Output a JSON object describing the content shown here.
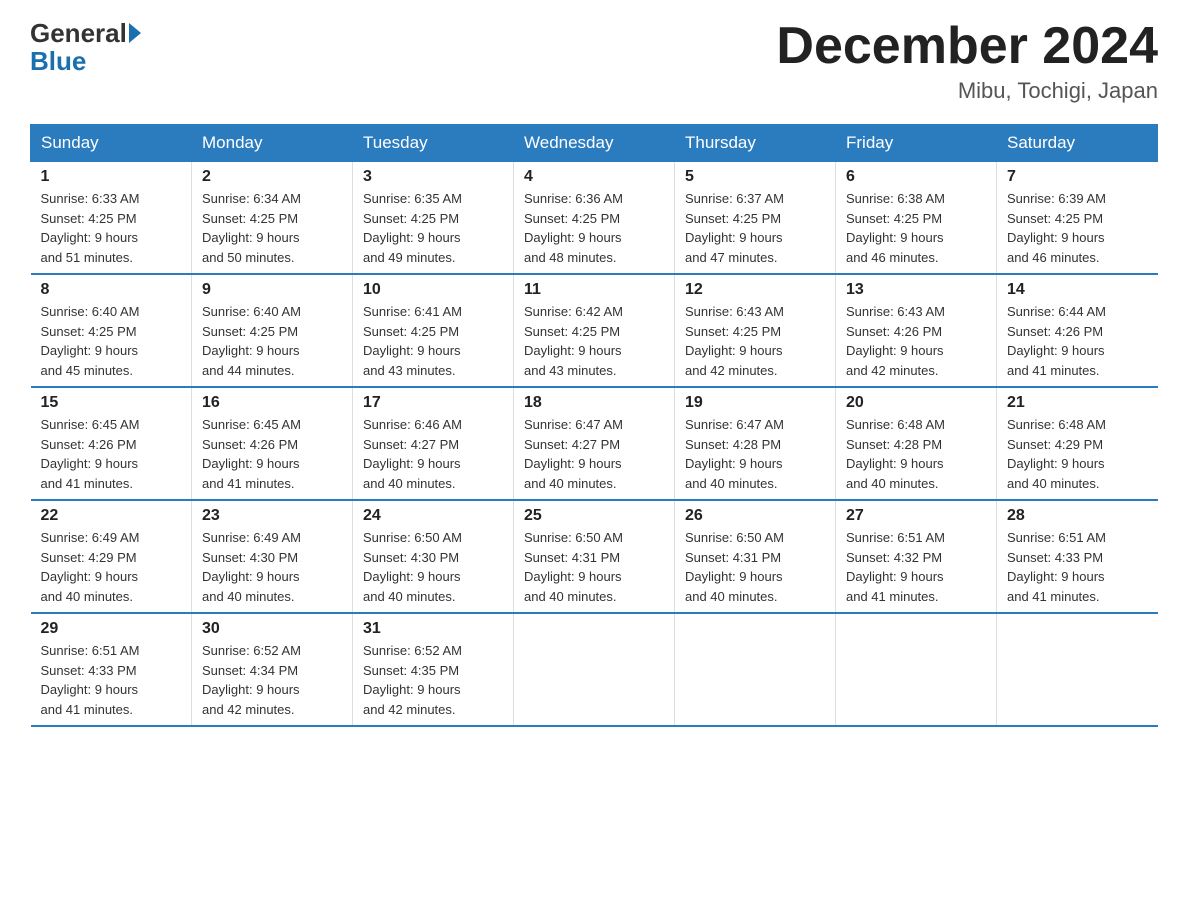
{
  "header": {
    "logo_general": "General",
    "logo_blue": "Blue",
    "month_title": "December 2024",
    "location": "Mibu, Tochigi, Japan"
  },
  "weekdays": [
    "Sunday",
    "Monday",
    "Tuesday",
    "Wednesday",
    "Thursday",
    "Friday",
    "Saturday"
  ],
  "weeks": [
    [
      {
        "day": "1",
        "sunrise": "6:33 AM",
        "sunset": "4:25 PM",
        "daylight": "9 hours and 51 minutes."
      },
      {
        "day": "2",
        "sunrise": "6:34 AM",
        "sunset": "4:25 PM",
        "daylight": "9 hours and 50 minutes."
      },
      {
        "day": "3",
        "sunrise": "6:35 AM",
        "sunset": "4:25 PM",
        "daylight": "9 hours and 49 minutes."
      },
      {
        "day": "4",
        "sunrise": "6:36 AM",
        "sunset": "4:25 PM",
        "daylight": "9 hours and 48 minutes."
      },
      {
        "day": "5",
        "sunrise": "6:37 AM",
        "sunset": "4:25 PM",
        "daylight": "9 hours and 47 minutes."
      },
      {
        "day": "6",
        "sunrise": "6:38 AM",
        "sunset": "4:25 PM",
        "daylight": "9 hours and 46 minutes."
      },
      {
        "day": "7",
        "sunrise": "6:39 AM",
        "sunset": "4:25 PM",
        "daylight": "9 hours and 46 minutes."
      }
    ],
    [
      {
        "day": "8",
        "sunrise": "6:40 AM",
        "sunset": "4:25 PM",
        "daylight": "9 hours and 45 minutes."
      },
      {
        "day": "9",
        "sunrise": "6:40 AM",
        "sunset": "4:25 PM",
        "daylight": "9 hours and 44 minutes."
      },
      {
        "day": "10",
        "sunrise": "6:41 AM",
        "sunset": "4:25 PM",
        "daylight": "9 hours and 43 minutes."
      },
      {
        "day": "11",
        "sunrise": "6:42 AM",
        "sunset": "4:25 PM",
        "daylight": "9 hours and 43 minutes."
      },
      {
        "day": "12",
        "sunrise": "6:43 AM",
        "sunset": "4:25 PM",
        "daylight": "9 hours and 42 minutes."
      },
      {
        "day": "13",
        "sunrise": "6:43 AM",
        "sunset": "4:26 PM",
        "daylight": "9 hours and 42 minutes."
      },
      {
        "day": "14",
        "sunrise": "6:44 AM",
        "sunset": "4:26 PM",
        "daylight": "9 hours and 41 minutes."
      }
    ],
    [
      {
        "day": "15",
        "sunrise": "6:45 AM",
        "sunset": "4:26 PM",
        "daylight": "9 hours and 41 minutes."
      },
      {
        "day": "16",
        "sunrise": "6:45 AM",
        "sunset": "4:26 PM",
        "daylight": "9 hours and 41 minutes."
      },
      {
        "day": "17",
        "sunrise": "6:46 AM",
        "sunset": "4:27 PM",
        "daylight": "9 hours and 40 minutes."
      },
      {
        "day": "18",
        "sunrise": "6:47 AM",
        "sunset": "4:27 PM",
        "daylight": "9 hours and 40 minutes."
      },
      {
        "day": "19",
        "sunrise": "6:47 AM",
        "sunset": "4:28 PM",
        "daylight": "9 hours and 40 minutes."
      },
      {
        "day": "20",
        "sunrise": "6:48 AM",
        "sunset": "4:28 PM",
        "daylight": "9 hours and 40 minutes."
      },
      {
        "day": "21",
        "sunrise": "6:48 AM",
        "sunset": "4:29 PM",
        "daylight": "9 hours and 40 minutes."
      }
    ],
    [
      {
        "day": "22",
        "sunrise": "6:49 AM",
        "sunset": "4:29 PM",
        "daylight": "9 hours and 40 minutes."
      },
      {
        "day": "23",
        "sunrise": "6:49 AM",
        "sunset": "4:30 PM",
        "daylight": "9 hours and 40 minutes."
      },
      {
        "day": "24",
        "sunrise": "6:50 AM",
        "sunset": "4:30 PM",
        "daylight": "9 hours and 40 minutes."
      },
      {
        "day": "25",
        "sunrise": "6:50 AM",
        "sunset": "4:31 PM",
        "daylight": "9 hours and 40 minutes."
      },
      {
        "day": "26",
        "sunrise": "6:50 AM",
        "sunset": "4:31 PM",
        "daylight": "9 hours and 40 minutes."
      },
      {
        "day": "27",
        "sunrise": "6:51 AM",
        "sunset": "4:32 PM",
        "daylight": "9 hours and 41 minutes."
      },
      {
        "day": "28",
        "sunrise": "6:51 AM",
        "sunset": "4:33 PM",
        "daylight": "9 hours and 41 minutes."
      }
    ],
    [
      {
        "day": "29",
        "sunrise": "6:51 AM",
        "sunset": "4:33 PM",
        "daylight": "9 hours and 41 minutes."
      },
      {
        "day": "30",
        "sunrise": "6:52 AM",
        "sunset": "4:34 PM",
        "daylight": "9 hours and 42 minutes."
      },
      {
        "day": "31",
        "sunrise": "6:52 AM",
        "sunset": "4:35 PM",
        "daylight": "9 hours and 42 minutes."
      },
      null,
      null,
      null,
      null
    ]
  ],
  "labels": {
    "sunrise": "Sunrise:",
    "sunset": "Sunset:",
    "daylight": "Daylight:"
  }
}
